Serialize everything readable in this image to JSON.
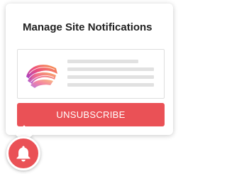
{
  "dialog": {
    "title": "Manage Site Notifications",
    "unsubscribe_label": "UNSUBSCRIBE"
  },
  "notification_preview": {
    "logo_icon": "site-logo-icon",
    "placeholder_lines": 4
  },
  "bell": {
    "icon": "bell-icon"
  },
  "colors": {
    "accent": "#ea5156",
    "placeholder": "#e1e1e1",
    "title_text": "#222222"
  }
}
